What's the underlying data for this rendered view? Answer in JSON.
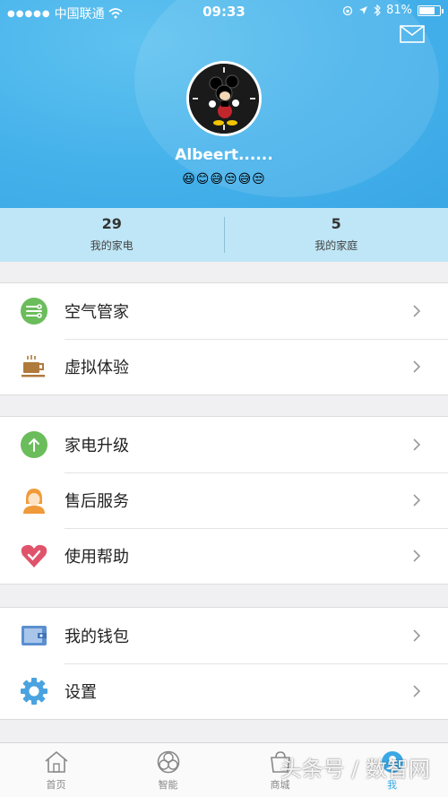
{
  "status_bar": {
    "carrier": "中国联通",
    "time": "09:33",
    "battery": "81%",
    "battery_level": 0.81
  },
  "profile": {
    "username": "Albeert......",
    "emoji_line": "😆😊😅😒😅😒"
  },
  "stats": [
    {
      "count": "29",
      "label": "我的家电"
    },
    {
      "count": "5",
      "label": "我的家庭"
    }
  ],
  "menu_groups": [
    [
      {
        "label": "空气管家",
        "icon": "air-butler-icon",
        "color": "#6bbd5b"
      },
      {
        "label": "虚拟体验",
        "icon": "coffee-cup-icon",
        "color": "#b07a3c"
      }
    ],
    [
      {
        "label": "家电升级",
        "icon": "upgrade-arrow-icon",
        "color": "#6bbd5b"
      },
      {
        "label": "售后服务",
        "icon": "service-person-icon",
        "color": "#f09a3a"
      },
      {
        "label": "使用帮助",
        "icon": "heart-help-icon",
        "color": "#e0546b"
      }
    ],
    [
      {
        "label": "我的钱包",
        "icon": "wallet-icon",
        "color": "#5b8fd0"
      },
      {
        "label": "设置",
        "icon": "gear-icon",
        "color": "#4aa3e0"
      }
    ]
  ],
  "tabs": [
    {
      "label": "首页",
      "icon": "home-icon"
    },
    {
      "label": "智能",
      "icon": "smart-icon"
    },
    {
      "label": "商城",
      "icon": "store-icon"
    },
    {
      "label": "我",
      "icon": "me-icon",
      "active": true
    }
  ],
  "watermark": "头条号 / 数智网",
  "colors": {
    "accent": "#3aa7e6",
    "header": "#44b1ea",
    "stats_bg": "#bfe6f6"
  }
}
